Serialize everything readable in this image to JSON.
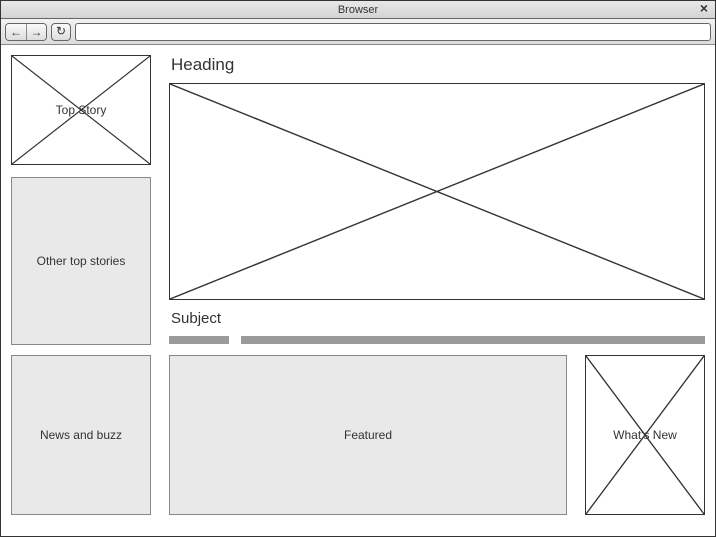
{
  "window": {
    "title": "Browser"
  },
  "toolbar": {
    "back_icon": "←",
    "forward_icon": "→",
    "reload_icon": "↻",
    "url_value": ""
  },
  "sidebar": {
    "top_story_label": "Top Story",
    "other_stories_label": "Other top stories"
  },
  "main": {
    "heading": "Heading",
    "subject": "Subject"
  },
  "bottom": {
    "news_buzz_label": "News and buzz",
    "featured_label": "Featured",
    "whats_new_label": "What's New"
  }
}
